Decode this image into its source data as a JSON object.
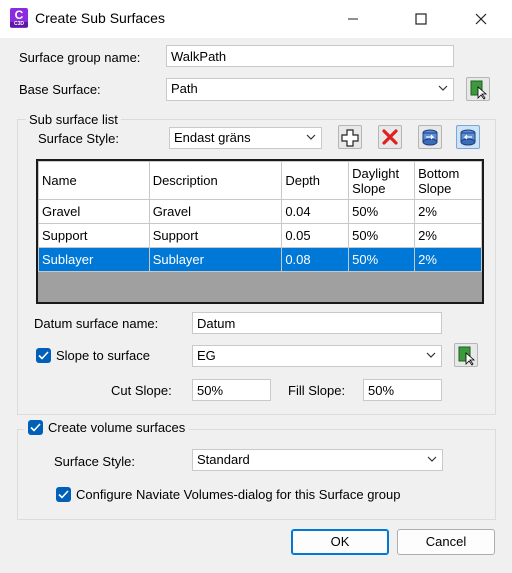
{
  "window": {
    "title": "Create Sub Surfaces",
    "app_icon_letter": "C",
    "app_icon_sub": "C3D"
  },
  "surface_group": {
    "label": "Surface group name:",
    "value": "WalkPath"
  },
  "base_surface": {
    "label": "Base Surface:",
    "value": "Path"
  },
  "sub_list": {
    "group_label": "Sub surface list",
    "style_label": "Surface Style:",
    "style_value": "Endast gräns",
    "columns": [
      "Name",
      "Description",
      "Depth",
      "Daylight Slope",
      "Bottom Slope"
    ],
    "rows": [
      {
        "name": "Gravel",
        "description": "Gravel",
        "depth": "0.04",
        "daylight": "50%",
        "bottom": "2%",
        "selected": false
      },
      {
        "name": "Support",
        "description": "Support",
        "depth": "0.05",
        "daylight": "50%",
        "bottom": "2%",
        "selected": false
      },
      {
        "name": "Sublayer",
        "description": "Sublayer",
        "depth": "0.08",
        "daylight": "50%",
        "bottom": "2%",
        "selected": true
      }
    ]
  },
  "datum": {
    "label": "Datum surface name:",
    "value": "Datum"
  },
  "slope": {
    "label": "Slope to surface",
    "checked": true,
    "value": "EG"
  },
  "cut": {
    "label": "Cut Slope:",
    "value": "50%"
  },
  "fill": {
    "label": "Fill Slope:",
    "value": "50%"
  },
  "volume": {
    "label": "Create volume surfaces",
    "checked": true,
    "style_label": "Surface Style:",
    "style_value": "Standard",
    "configure_label": "Configure Naviate Volumes-dialog for this Surface group",
    "configure_checked": true
  },
  "buttons": {
    "ok": "OK",
    "cancel": "Cancel"
  },
  "colors": {
    "selection": "#0078d7",
    "checkbox": "#005fb8",
    "accent_border": "#0078d4"
  }
}
